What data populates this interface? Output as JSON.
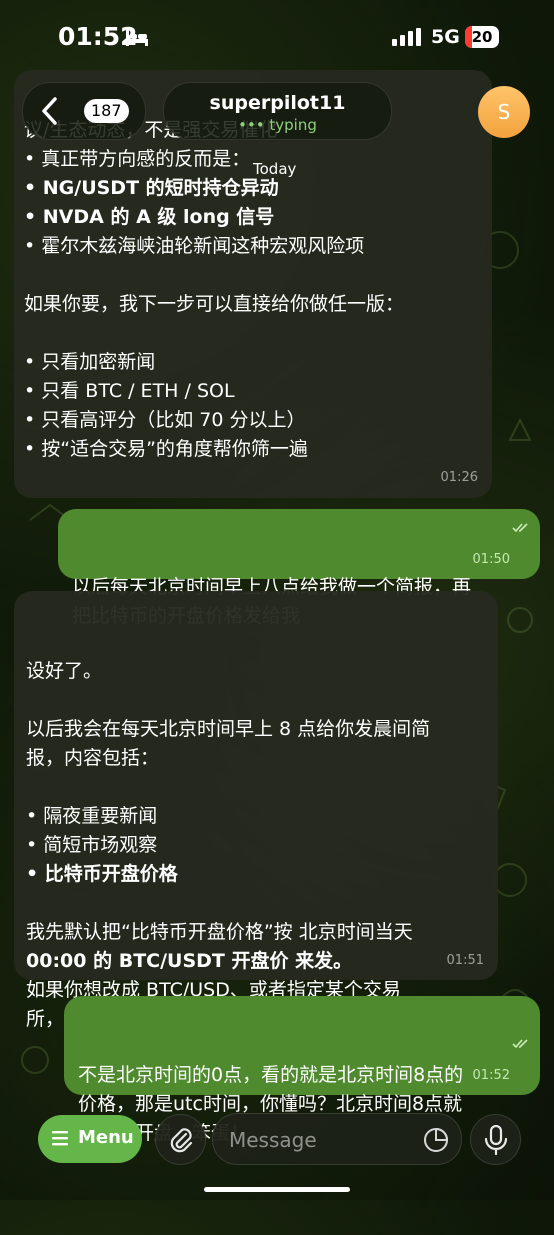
{
  "status_bar": {
    "time": "01:52",
    "network": "5G",
    "battery": "20"
  },
  "header": {
    "back_count": "187",
    "contact_name": "superpilot11",
    "contact_status": "typing",
    "avatar_letter": "S"
  },
  "date_chip": "Today",
  "messages": [
    {
      "direction": "in",
      "lines": [
        {
          "text": "议/生态动态，不是强交易催化",
          "bold": false
        },
        {
          "text": "• 真正带方向感的反而是：",
          "bold": false
        },
        {
          "text": "• NG/USDT 的短时持仓异动",
          "bold": true
        },
        {
          "text": "• NVDA 的 A 级 long 信号",
          "bold": true
        },
        {
          "text": "• 霍尔木兹海峡油轮新闻这种宏观风险项",
          "bold": false
        },
        {
          "text": "",
          "bold": false
        },
        {
          "text": "如果你要，我下一步可以直接给你做任一版：",
          "bold": false
        },
        {
          "text": "",
          "bold": false
        },
        {
          "text": "• 只看加密新闻",
          "bold": false
        },
        {
          "text": "• 只看 BTC / ETH / SOL",
          "bold": false
        },
        {
          "text": "• 只看高评分（比如 70 分以上）",
          "bold": false
        },
        {
          "text": "• 按“适合交易”的角度帮你筛一遍",
          "bold": false
        }
      ],
      "time": "01:26"
    },
    {
      "direction": "out",
      "lines": [
        {
          "text": "以后每天北京时间早上八点给我做一个简报，再",
          "bold": false
        },
        {
          "text": "把比特币的开盘价格发给我",
          "bold": false
        }
      ],
      "time": "01:50"
    },
    {
      "direction": "in",
      "lines": [
        {
          "text": "设好了。",
          "bold": false
        },
        {
          "text": "",
          "bold": false
        },
        {
          "text": "以后我会在每天北京时间早上 8 点给你发晨间简",
          "bold": false
        },
        {
          "text": "报，内容包括：",
          "bold": false
        },
        {
          "text": "",
          "bold": false
        },
        {
          "text": "• 隔夜重要新闻",
          "bold": false
        },
        {
          "text": "• 简短市场观察",
          "bold": false
        },
        {
          "text": "• 比特币开盘价格",
          "bold": true
        },
        {
          "text": "",
          "bold": false
        },
        {
          "text": "我先默认把“比特币开盘价格”按 北京时间当天",
          "bold": false
        },
        {
          "text": "00:00 的 BTC/USDT 开盘价 来发。",
          "bold": true
        },
        {
          "text": "如果你想改成 BTC/USD、或者指定某个交易",
          "bold": false
        },
        {
          "text": "所，也可以，我再给你改。",
          "bold": false
        }
      ],
      "time": "01:51"
    },
    {
      "direction": "out",
      "lines": [
        {
          "text": "不是北京时间的0点，看的就是北京时间8点的",
          "bold": false
        },
        {
          "text": "价格，那是utc时间，你懂吗？北京时间8点就",
          "bold": false
        },
        {
          "text": "是日线开盘，笨蛋！",
          "bold": false
        }
      ],
      "time": "01:52"
    }
  ],
  "composer": {
    "menu_label": "Menu",
    "placeholder": "Message"
  },
  "colors": {
    "outgoing_bubble": "#4f8a2f",
    "incoming_bubble": "#262a1e",
    "menu_button": "#64b648",
    "typing": "#8fcf7a"
  }
}
